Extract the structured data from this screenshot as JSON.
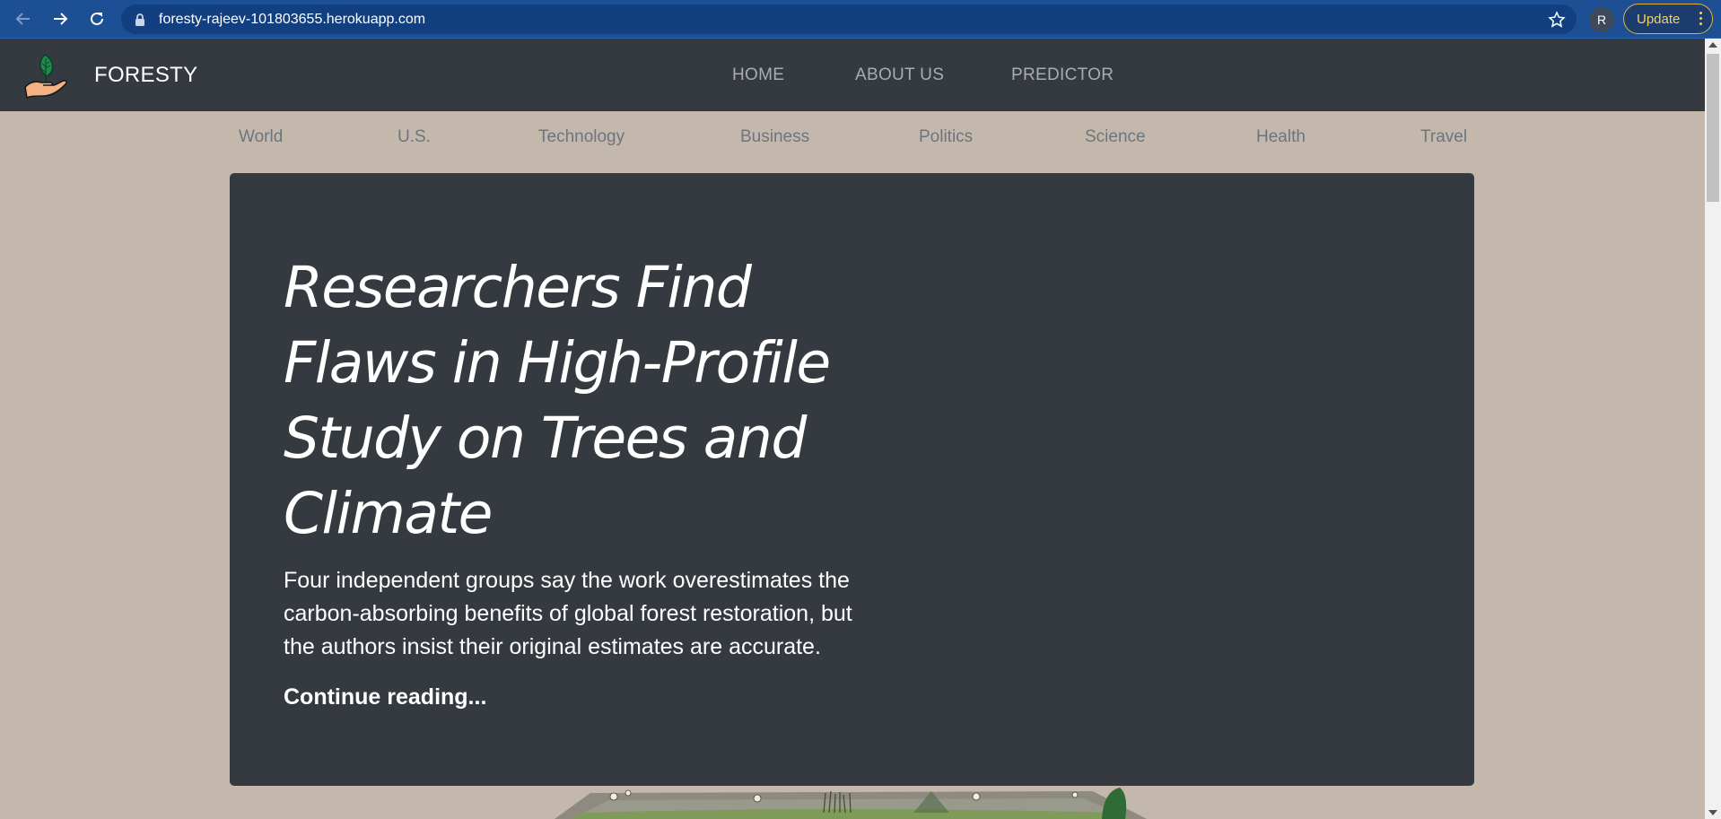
{
  "browser": {
    "url": "foresty-rajeev-101803655.herokuapp.com",
    "profile_initial": "R",
    "update_label": "Update",
    "icons": [
      "back-arrow-icon",
      "forward-arrow-icon",
      "reload-icon",
      "lock-icon",
      "star-icon",
      "menu-dots-icon"
    ],
    "colors": {
      "toolbar": "#1c4f94",
      "update_accent": "#e6b33a"
    }
  },
  "navbar": {
    "brand": "FORESTY",
    "links": [
      "HOME",
      "ABOUT US",
      "PREDICTOR"
    ],
    "background": "#343a40"
  },
  "categories": [
    "World",
    "U.S.",
    "Technology",
    "Business",
    "Politics",
    "Science",
    "Health",
    "Travel"
  ],
  "hero": {
    "title": "Researchers Find Flaws in High-Profile Study on Trees and Climate",
    "lead": "Four independent groups say the work overestimates the carbon-absorbing benefits of global forest restoration, but the authors insist their original estimates are accurate.",
    "cta": "Continue reading..."
  },
  "colors": {
    "page_background": "#c4b8ad",
    "hero_background": "#343a40",
    "category_text": "#6c757d"
  }
}
